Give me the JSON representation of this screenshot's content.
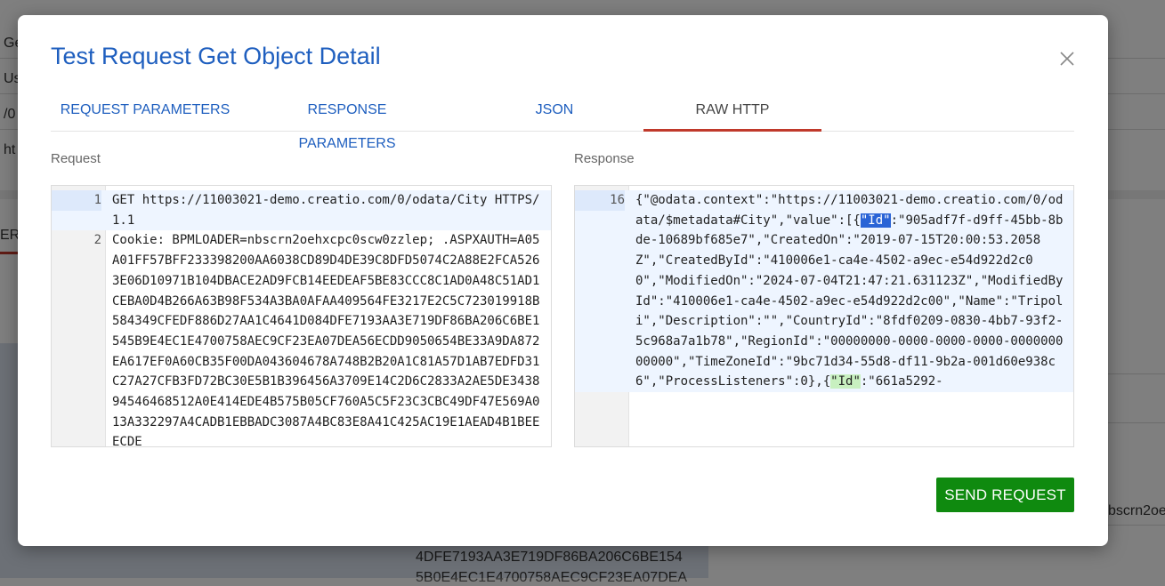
{
  "background": {
    "rows": [
      "Ge",
      "Us",
      "/0",
      "ht"
    ],
    "tab_fragment": "ERS",
    "right_fragment": "bscrn2oe",
    "code_lines": [
      "4DFE7193AA3E719DF86BA206C6BE154",
      "5B0E4EC1E4700758AEC9CF23EA07DEA"
    ]
  },
  "modal": {
    "title": "Test Request Get Object Detail",
    "tabs": [
      {
        "label": "REQUEST PARAMETERS"
      },
      {
        "label": "RESPONSE PARAMETERS"
      },
      {
        "label": "JSON"
      },
      {
        "label": "RAW HTTP",
        "active": true
      }
    ],
    "request": {
      "label": "Request",
      "lines": [
        {
          "n": "1",
          "text": "GET https://11003021-demo.creatio.com/0/odata/City HTTPS/1.1"
        },
        {
          "n": "2",
          "text": "Cookie: BPMLOADER=nbscrn2oehxcpc0scw0zzlep; .ASPXAUTH=A05A01FF57BFF233398200AA6038CD89D4DE39C8DFD5074C2A88E2FCA5263E06D10971B104DBACE2AD9FCB14EEDEAF5BE83CCC8C1AD0A48C51AD1CEBA0D4B266A63B98F534A3BA0AFAA409564FE3217E2C5C723019918B584349CFEDF886D27AA1C4641D084DFE7193AA3E719DF86BA206C6BE1545B9E4EC1E4700758AEC9CF23EA07DEA56ECDD9050654BE33A9DA872EA617EF0A60CB35F00DA043604678A748B2B20A1C81A57D1AB7EDFD31C27A27CFB3FD72BC30E5B1B396456A3709E14C2D6C2833A2AE5DE343894546468512A0E414EDE4B575B05CF760A5C5F23C3CBC49DF47E569A013A332297A4CADB1EBBADC3087A4BC83E8A41C425AC19E1AEAD4B1BEEECDE"
        }
      ]
    },
    "response": {
      "label": "Response",
      "line_number": "16",
      "segments": {
        "pre": "{\"@odata.context\":\"https://11003021-demo.creatio.com/0/odata/$metadata#City\",\"value\":[{",
        "sel": "\"Id\"",
        "mid": ":\"905adf7f-d9ff-45bb-8bde-10689bf685e7\",\"CreatedOn\":\"2019-07-15T20:00:53.2058Z\",\"CreatedById\":\"410006e1-ca4e-4502-a9ec-e54d922d2c00\",\"ModifiedOn\":\"2024-07-04T21:47:21.631123Z\",\"ModifiedById\":\"410006e1-ca4e-4502-a9ec-e54d922d2c00\",\"Name\":\"Tripoli\",\"Description\":\"\",\"CountryId\":\"8fdf0209-0830-4bb7-93f2-5c968a7a1b78\",\"RegionId\":\"00000000-0000-0000-0000-000000000000\",\"TimeZoneId\":\"9bc71d34-55d8-df11-9b2a-001d60e938c6\",\"ProcessListeners\":0},{",
        "match": "\"Id\"",
        "post": ":\"661a5292-"
      }
    },
    "send_button": "SEND REQUEST"
  }
}
